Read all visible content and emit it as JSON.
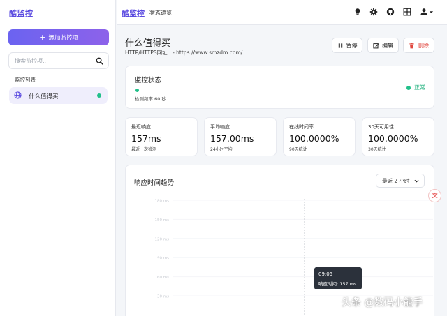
{
  "sidebar": {
    "brand": "酷监控",
    "add_button": "添加监控项",
    "search_placeholder": "搜索监控项...",
    "list_label": "监控列表",
    "items": [
      {
        "name": "什么值得买",
        "status_color": "#22c08a"
      }
    ]
  },
  "topbar": {
    "logo": "酷监控",
    "overview": "状态速览",
    "icons": [
      "bulb-icon",
      "gear-icon",
      "github-icon",
      "grid-icon",
      "user-icon",
      "chevron-down-icon"
    ]
  },
  "monitor": {
    "title": "什么值得买",
    "protocol": "HTTP/HTTPS网址",
    "url": "- https://www.smzdm.com/",
    "buttons": {
      "pause": "暂停",
      "edit": "编辑",
      "delete": "删除"
    }
  },
  "status": {
    "heading": "监控状态",
    "frequency": "检测频率 60 秒",
    "state": "正常"
  },
  "metrics": [
    {
      "label": "最近响应",
      "value": "157ms",
      "note": "最近一次检测"
    },
    {
      "label": "平均响应",
      "value": "157.00ms",
      "note": "24小时平均"
    },
    {
      "label": "在线时间率",
      "value": "100.0000%",
      "note": "90天统计"
    },
    {
      "label": "30天可用性",
      "value": "100.0000%",
      "note": "30天统计"
    }
  ],
  "chart": {
    "heading": "响应时间趋势",
    "range_selected": "最近 2 小时",
    "tooltip_time": "09:05",
    "tooltip_value": "响应时间: 157 ms"
  },
  "chart_data": {
    "type": "line",
    "title": "响应时间趋势",
    "y_ticks": [
      "180 ms",
      "150 ms",
      "120 ms",
      "90 ms",
      "60 ms",
      "30 ms"
    ],
    "ylim": [
      0,
      180
    ],
    "x": [
      "09:05"
    ],
    "series": [
      {
        "values": [
          157
        ]
      }
    ],
    "grid": true
  },
  "colors": {
    "accent": "#5b4be0",
    "success": "#22c08a",
    "danger": "#e0463d"
  },
  "float_badge": "文",
  "watermark": "头条 @数码小能手"
}
